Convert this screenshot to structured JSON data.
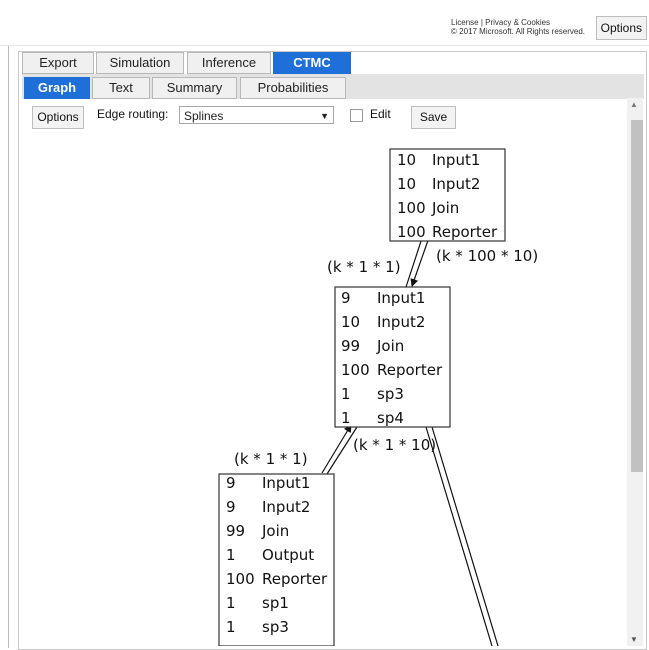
{
  "header": {
    "legal_line1": "License | Privacy & Cookies",
    "legal_line2": "© 2017 Microsoft. All Rights reserved.",
    "options_label": "Options"
  },
  "main_tabs": [
    "Export",
    "Simulation",
    "Inference",
    "CTMC"
  ],
  "active_main_tab": "CTMC",
  "sub_tabs": [
    "Graph",
    "Text",
    "Summary",
    "Probabilities"
  ],
  "active_sub_tab": "Graph",
  "toolbar": {
    "options_label": "Options",
    "edge_routing_label": "Edge routing:",
    "edge_routing_value": "Splines",
    "edit_label": "Edit",
    "edit_checked": false,
    "save_label": "Save"
  },
  "graph": {
    "nodes": [
      {
        "id": "n1",
        "rows": [
          [
            "10",
            "Input1"
          ],
          [
            "10",
            "Input2"
          ],
          [
            "100",
            "Join"
          ],
          [
            "100",
            "Reporter"
          ]
        ]
      },
      {
        "id": "n2",
        "rows": [
          [
            "9",
            "Input1"
          ],
          [
            "10",
            "Input2"
          ],
          [
            "99",
            "Join"
          ],
          [
            "100",
            "Reporter"
          ],
          [
            "1",
            "sp3"
          ],
          [
            "1",
            "sp4"
          ]
        ]
      },
      {
        "id": "n3",
        "rows": [
          [
            "9",
            "Input1"
          ],
          [
            "9",
            "Input2"
          ],
          [
            "99",
            "Join"
          ],
          [
            "1",
            "Output"
          ],
          [
            "100",
            "Reporter"
          ],
          [
            "1",
            "sp1"
          ],
          [
            "1",
            "sp3"
          ]
        ]
      }
    ],
    "edges": [
      {
        "from": "n1",
        "to": "n2",
        "label": "(k * 100 * 10)"
      },
      {
        "from": "n2",
        "to": "n1",
        "label": "(k * 1 * 1)"
      },
      {
        "from": "n2",
        "to": "n3",
        "label": "(k * 1 * 10)"
      },
      {
        "from": "n3",
        "to": "n2",
        "label": "(k * 1 * 1)"
      }
    ]
  }
}
